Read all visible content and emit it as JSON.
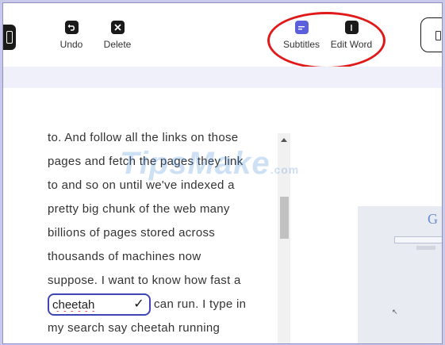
{
  "toolbar": {
    "undo_label": "Undo",
    "delete_label": "Delete",
    "subtitles_label": "Subtitles",
    "edit_word_label": "Edit Word"
  },
  "transcript": {
    "lines": [
      "to. And follow all the links on those",
      "pages and fetch the pages they link",
      "to and so on until we've indexed a",
      "pretty big chunk of the web many",
      "billions of pages stored across",
      "thousands of machines now",
      "suppose. I want to know how fast a"
    ],
    "edit_word_value": "cheetah",
    "after_edit_text": "can run. I type in",
    "last_line": "my search say cheetah running"
  },
  "watermark": {
    "text": "TipsMake",
    "suffix": ".com"
  },
  "video_thumb": {
    "logo_text": "G"
  },
  "colors": {
    "accent": "#5b5fdc",
    "highlight": "#e01a1a",
    "edit_border": "#3f45b6"
  }
}
